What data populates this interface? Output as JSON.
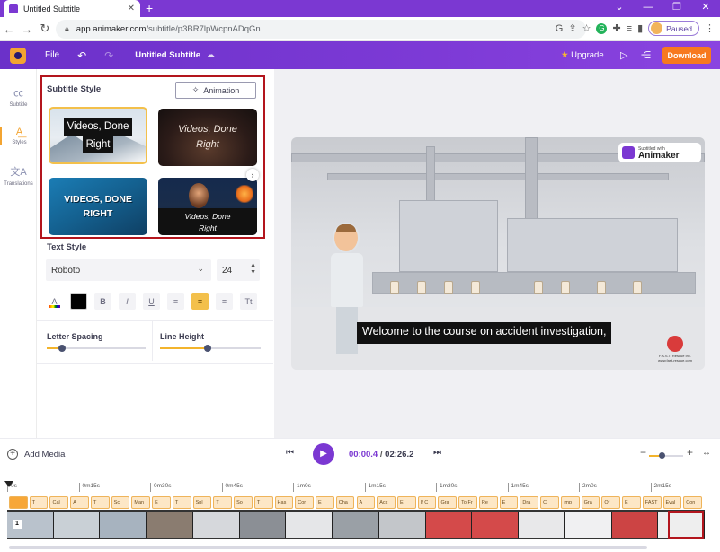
{
  "browser": {
    "tab_title": "Untitled Subtitle",
    "url_host": "app.animaker.com",
    "url_path": "/subtitle/p3BR7lpWcpnADqGn",
    "profile_status": "Paused"
  },
  "header": {
    "file_label": "File",
    "doc_title": "Untitled Subtitle",
    "upgrade_label": "Upgrade",
    "download_label": "Download",
    "colors": {
      "bar": "#7b38d2",
      "download": "#f7791f"
    }
  },
  "rail": {
    "items": [
      {
        "label": "Subtitle",
        "icon": "cc-icon"
      },
      {
        "label": "Styles",
        "icon": "text-style-icon",
        "active": true
      },
      {
        "label": "Translations",
        "icon": "translate-icon"
      }
    ]
  },
  "subtitle_style": {
    "title": "Subtitle Style",
    "animation_label": "Animation",
    "presets": [
      {
        "line1": "Videos, Done",
        "line2": "Right"
      },
      {
        "line1": "Videos, Done",
        "line2": "Right"
      },
      {
        "line1": "VIDEOS, DONE",
        "line2": "RIGHT"
      },
      {
        "line1": "Videos, Done",
        "line2": "Right"
      }
    ]
  },
  "text_style": {
    "title": "Text Style",
    "font": "Roboto",
    "size": "24",
    "color_swatch": "#000000",
    "format_buttons": [
      "B",
      "I",
      "U"
    ],
    "case_label": "Tt",
    "alignment": "center"
  },
  "spacing": {
    "letter_spacing_label": "Letter Spacing",
    "letter_spacing_level": 0.15,
    "line_height_label": "Line Height",
    "line_height_level": 0.47
  },
  "preview": {
    "watermark_top": "Subtitled with",
    "watermark_brand": "Animaker",
    "caption": "Welcome to the course on accident investigation,",
    "corner_logo_text": "F.A.S.T. Rescue Inc.\nwww.fast-rescue.com"
  },
  "player": {
    "add_media_label": "Add Media",
    "current_time": "00:00.4",
    "separator": "/",
    "total_time": "02:26.2",
    "zoom_level": 0.4
  },
  "timeline": {
    "ticks": [
      "0s",
      "0m15s",
      "0m30s",
      "0m45s",
      "1m0s",
      "1m15s",
      "1m30s",
      "1m45s",
      "2m0s",
      "2m15s"
    ],
    "clip_badge": "1",
    "subtitle_clips": [
      "",
      "T",
      "Cal",
      "A",
      "T",
      "Sc",
      "Man",
      "E",
      "T",
      "Spl",
      "T",
      "So",
      "T",
      "Has",
      "Cor",
      "E",
      "Cha",
      "A",
      "Acc",
      "E",
      "If C",
      "Gra",
      "To Fr",
      "Re",
      "E",
      "Dra",
      "C",
      "Imp",
      "Gra",
      "Of",
      "E",
      "FAST",
      "Eval",
      "Con"
    ]
  }
}
